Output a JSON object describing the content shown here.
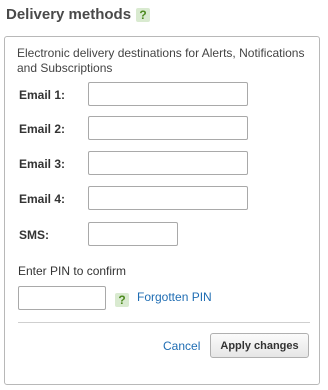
{
  "header": {
    "title": "Delivery methods",
    "help_icon": "question-mark-icon"
  },
  "description": "Electronic delivery destinations for Alerts, Notifications and Subscriptions",
  "fields": {
    "email1_label": "Email 1:",
    "email2_label": "Email 2:",
    "email3_label": "Email 3:",
    "email4_label": "Email 4:",
    "sms_label": "SMS:",
    "email1_value": "",
    "email2_value": "",
    "email3_value": "",
    "email4_value": "",
    "sms_value": ""
  },
  "pin": {
    "label": "Enter PIN to confirm",
    "value": "",
    "help_icon": "question-mark-icon",
    "forgotten_link": "Forgotten PIN"
  },
  "actions": {
    "cancel": "Cancel",
    "apply": "Apply changes"
  },
  "colors": {
    "link": "#1f6db3",
    "help_icon_bg": "#d9ead0",
    "help_icon_fg": "#4d8a1f"
  }
}
